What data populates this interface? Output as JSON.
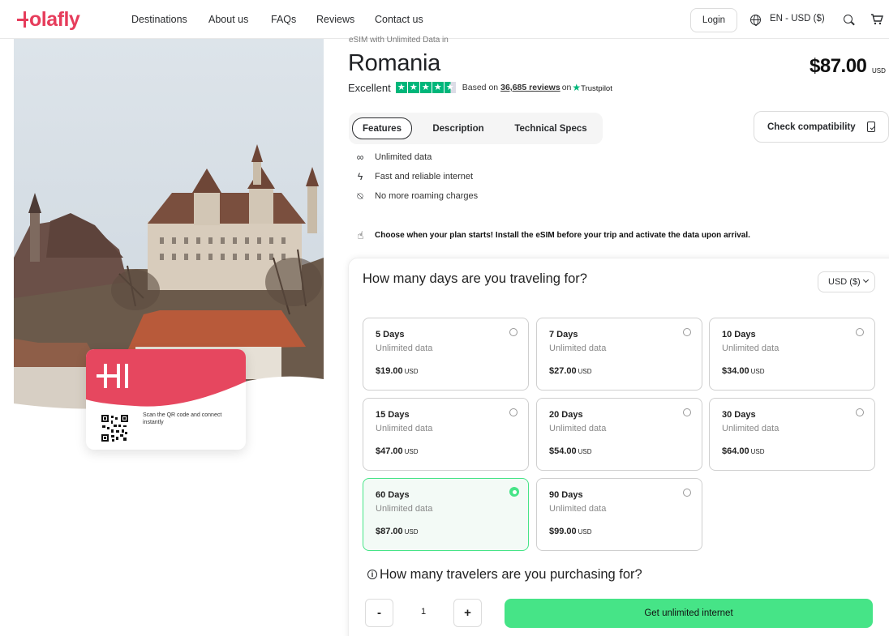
{
  "header": {
    "brand": "Holafly",
    "nav": [
      "Destinations",
      "About us",
      "FAQs",
      "Reviews",
      "Contact us"
    ],
    "login_label": "Login",
    "language_label": "EN - USD ($)"
  },
  "card": {
    "scan_text": "Scan the QR code and connect instantly"
  },
  "product": {
    "subtitle": "eSIM with Unlimited Data in",
    "title": "Romania",
    "price": "$87.00",
    "price_currency": "USD",
    "rating_label": "Excellent",
    "rating_stars": 4.5,
    "based_prefix": "Based on",
    "reviews_count": "36,685 reviews",
    "based_suffix": "on",
    "trustpilot": "Trustpilot"
  },
  "tabs": [
    {
      "label": "Features",
      "active": true
    },
    {
      "label": "Description",
      "active": false
    },
    {
      "label": "Technical Specs",
      "active": false
    }
  ],
  "compatibility_label": "Check compatibility",
  "features": [
    {
      "icon": "infinity-icon",
      "label": "Unlimited data"
    },
    {
      "icon": "lightning-icon",
      "label": "Fast and reliable internet"
    },
    {
      "icon": "no-roaming-icon",
      "label": "No more roaming charges"
    }
  ],
  "plan_note": "Choose when your plan starts! Install the eSIM before your trip and activate the data upon arrival.",
  "selector": {
    "question": "How many days are you traveling for?",
    "currency": "USD ($)",
    "options": [
      {
        "days": "5 Days",
        "data": "Unlimited data",
        "price": "$19.00",
        "currency": "USD",
        "selected": false
      },
      {
        "days": "7 Days",
        "data": "Unlimited data",
        "price": "$27.00",
        "currency": "USD",
        "selected": false
      },
      {
        "days": "10 Days",
        "data": "Unlimited data",
        "price": "$34.00",
        "currency": "USD",
        "selected": false
      },
      {
        "days": "15 Days",
        "data": "Unlimited data",
        "price": "$47.00",
        "currency": "USD",
        "selected": false
      },
      {
        "days": "20 Days",
        "data": "Unlimited data",
        "price": "$54.00",
        "currency": "USD",
        "selected": false
      },
      {
        "days": "30 Days",
        "data": "Unlimited data",
        "price": "$64.00",
        "currency": "USD",
        "selected": false
      },
      {
        "days": "60 Days",
        "data": "Unlimited data",
        "price": "$87.00",
        "currency": "USD",
        "selected": true
      },
      {
        "days": "90 Days",
        "data": "Unlimited data",
        "price": "$99.00",
        "currency": "USD",
        "selected": false
      }
    ]
  },
  "travelers": {
    "question": "How many travelers are you purchasing for?",
    "minus": "-",
    "quantity": "1",
    "plus": "+",
    "cta": "Get unlimited internet"
  },
  "colors": {
    "brand": "#e63c5b",
    "accent_green": "#46e487",
    "trustpilot_green": "#00b67a"
  }
}
